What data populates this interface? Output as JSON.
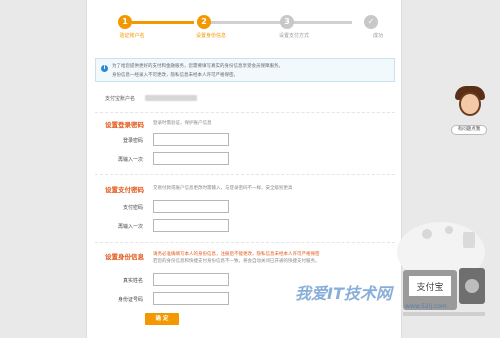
{
  "steps": [
    {
      "number": "1",
      "label": "验证账户名",
      "state": "done"
    },
    {
      "number": "2",
      "label": "设置身份信息",
      "state": "active"
    },
    {
      "number": "3",
      "label": "设置支付方式",
      "state": "todo"
    },
    {
      "number": "✓",
      "label": "成功",
      "state": "todo"
    }
  ],
  "colors": {
    "accent": "#f39800",
    "section_title": "#e2581a",
    "inactive": "#c8c8c8"
  },
  "notice": {
    "icon": "info-icon",
    "line1": "为了给您提供更好的支付和金融服务，您需要填写真实的身份信息享受会员保障服务。",
    "line2": "身份信息一经录入不可更改，隐私信息未经本人许可严格保密。"
  },
  "account": {
    "label": "支付宝账户名"
  },
  "login_password": {
    "title": "设置登录密码",
    "desc": "登录时需验证，保护账户信息",
    "password_label": "登录密码",
    "confirm_label": "再输入一次"
  },
  "pay_password": {
    "title": "设置支付密码",
    "desc": "交易付款或账户信息更改时需输入，与登录密码不一样，安全级别更高",
    "password_label": "支付密码",
    "confirm_label": "再输入一次"
  },
  "identity": {
    "title": "设置身份信息",
    "desc_line1": "请务必准确填写本人的身份信息，注册后不能更改，隐私信息未经本人许可严格保密",
    "desc_line2": "若您的身份信息和快捷支付身份信息不一致，将会自动关闭已开通的快捷支付服务。",
    "name_label": "真实姓名",
    "id_label": "身份证号码"
  },
  "submit_label": "确 定",
  "sidebar": {
    "help_label": "有问题点我"
  },
  "illustration": {
    "brand": "支付宝",
    "icon": "alipay-wallet-illustration"
  },
  "watermark": {
    "text": "我爱IT技术网",
    "sub": "www.52ij.com"
  }
}
